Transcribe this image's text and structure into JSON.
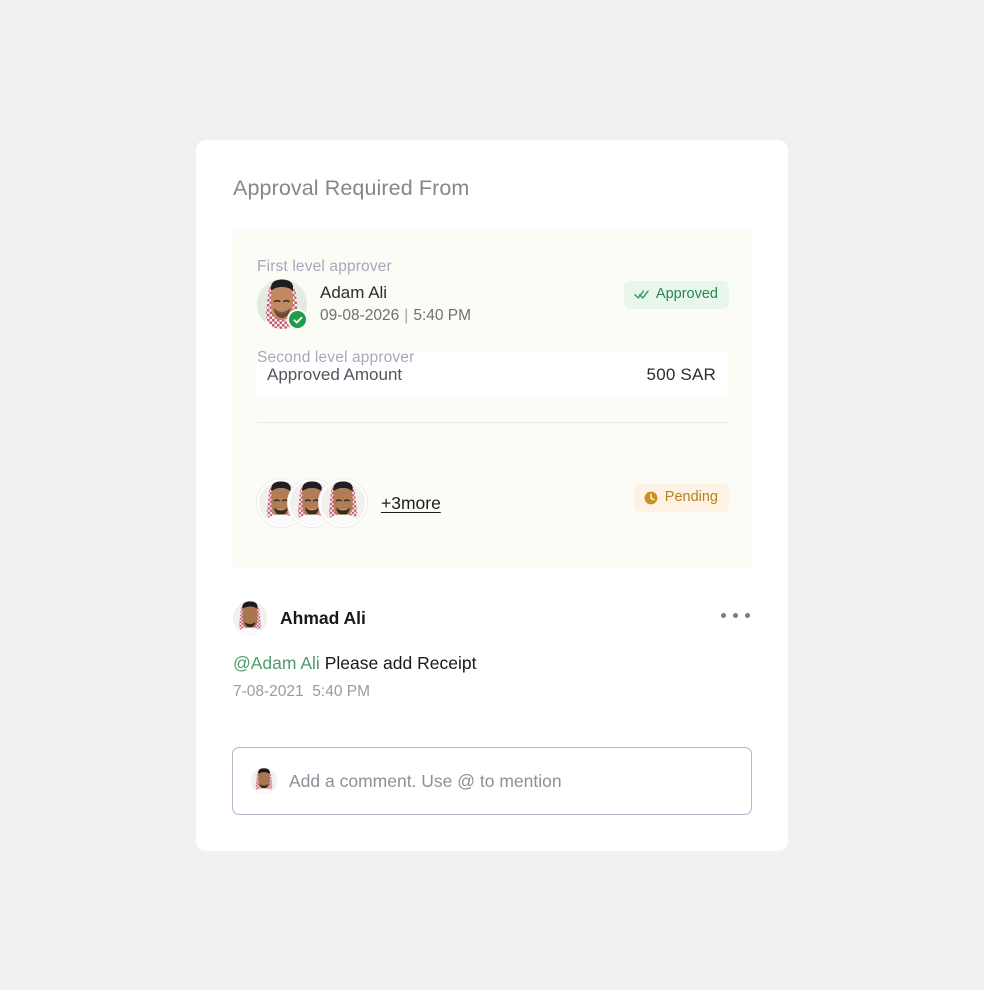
{
  "card": {
    "title": "Approval Required From"
  },
  "approvals": {
    "first_level": {
      "label": "First level approver",
      "approver": {
        "name": "Adam Ali",
        "date": "09-08-2026",
        "separator": "|",
        "time": "5:40 PM",
        "verified": true
      },
      "status": {
        "label": "Approved",
        "icon": "double-check-icon",
        "text_color": "#23894a",
        "bg_color": "#e9f6ec"
      },
      "amount": {
        "label": "Approved Amount",
        "value": "500 SAR"
      }
    },
    "second_level": {
      "label": "Second level approver",
      "avatar_count": 3,
      "more_link": "+3more",
      "status": {
        "label": "Pending",
        "icon": "clock-icon",
        "text_color": "#b4831c",
        "bg_color": "#fdf2e4"
      }
    }
  },
  "comment": {
    "author": "Ahmad Ali",
    "menu_icon": "kebab-menu-icon",
    "mention": "@Adam Ali",
    "text": " Please add Receipt",
    "date": "7-08-2021",
    "time": "5:40 PM"
  },
  "comment_input": {
    "placeholder": "Add a comment. Use @ to mention"
  },
  "theme": {
    "page_bg": "#f1f1f1",
    "card_bg": "#ffffff",
    "panel_bg": "#fbfcf6",
    "accent_green": "#1f9e4a",
    "accent_amber": "#c8921f",
    "mention_green": "#4f9c6b"
  }
}
